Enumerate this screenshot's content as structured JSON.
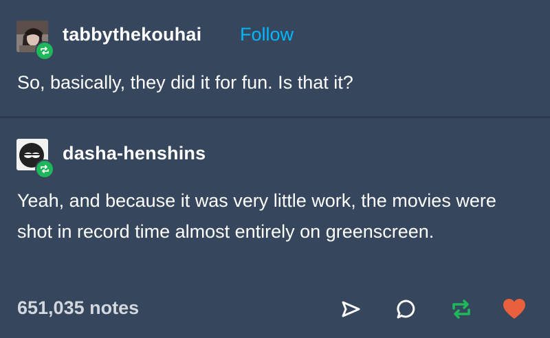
{
  "posts": [
    {
      "username": "tabbythekouhai",
      "follow_label": "Follow",
      "text": "So, basically, they did it for fun. Is that it?"
    },
    {
      "username": "dasha-henshins",
      "text": "Yeah, and because it was very little work, the movies were shot in record time almost entirely on greenscreen."
    }
  ],
  "footer": {
    "notes": "651,035 notes"
  },
  "icons": {
    "share": "share-icon",
    "reply": "reply-icon",
    "reblog": "reblog-icon",
    "like": "heart-icon",
    "reblog_badge": "reblog-badge-icon"
  },
  "colors": {
    "background": "#36465d",
    "follow": "#00b8ff",
    "reblog_green": "#1fb75a",
    "heart": "#e8613c",
    "notes": "#d3d8de"
  }
}
